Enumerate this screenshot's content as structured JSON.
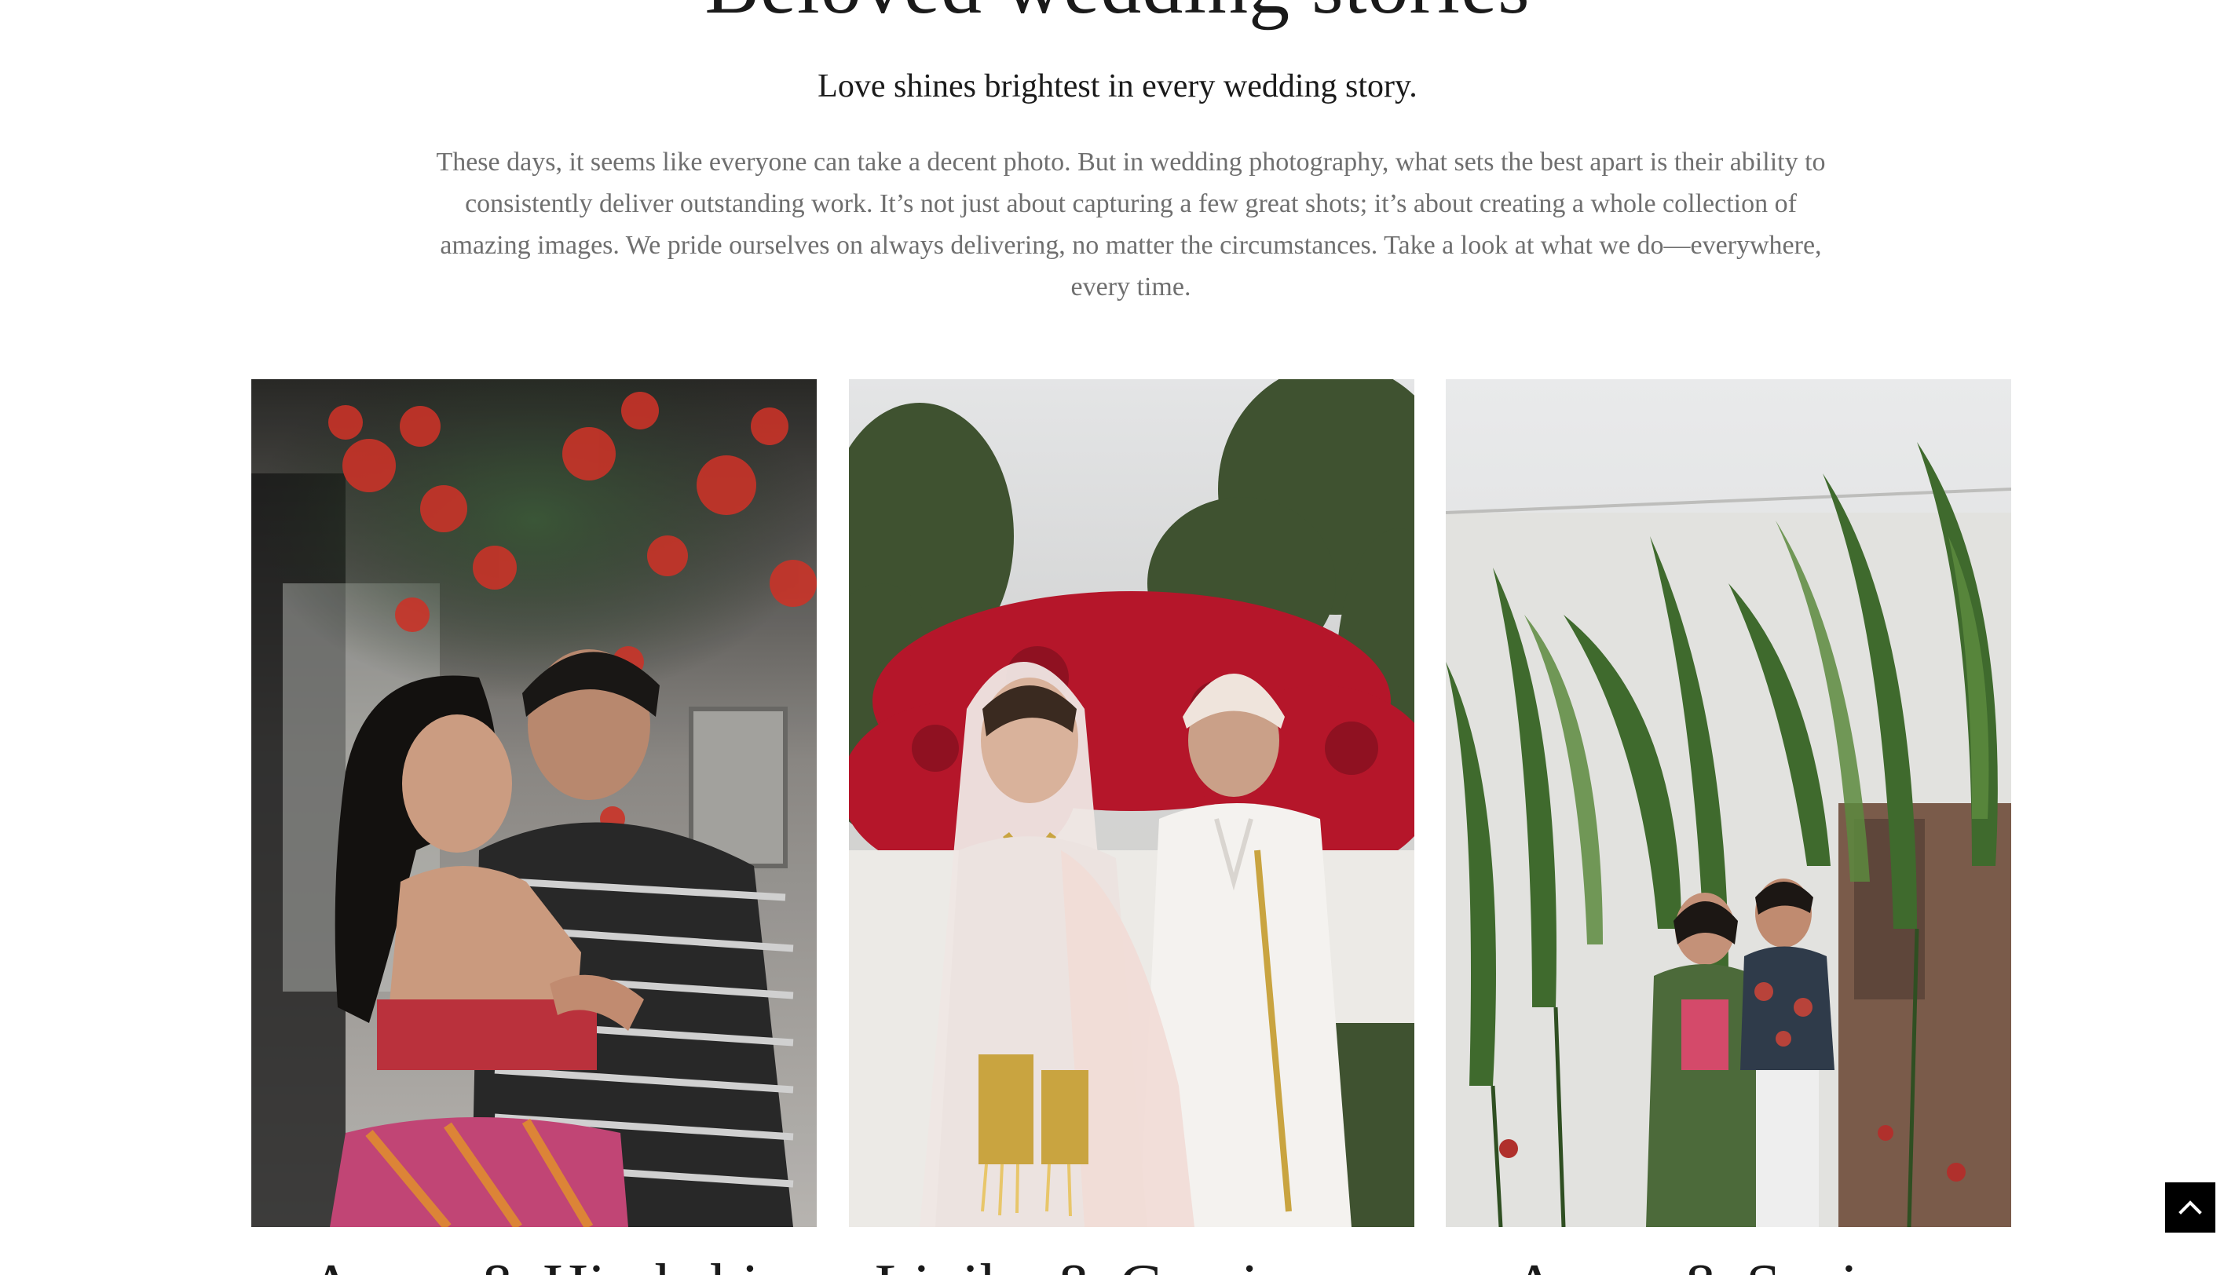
{
  "section": {
    "title": "Beloved wedding stories",
    "subtitle": "Love shines brightest in every wedding story.",
    "intro": "These days, it seems like everyone can take a decent photo. But in wedding photography, what sets the best apart is their ability to consistently deliver outstanding work. It’s not just about capturing a few great shots; it’s about creating a whole collection of amazing images. We pride ourselves on always delivering, no matter the circumstances. Take a look at what we do—everywhere, every time."
  },
  "stories": [
    {
      "couple": "Anam & Himkshi"
    },
    {
      "couple": "Lipika & Gursimran"
    },
    {
      "couple": "Aarav & Sanjana"
    }
  ],
  "back_to_top": {
    "icon": "chevron-up-icon"
  },
  "colors": {
    "background": "#ffffff",
    "heading": "#1a1a1a",
    "body_text": "#6f6f6f",
    "button": "#000000"
  }
}
